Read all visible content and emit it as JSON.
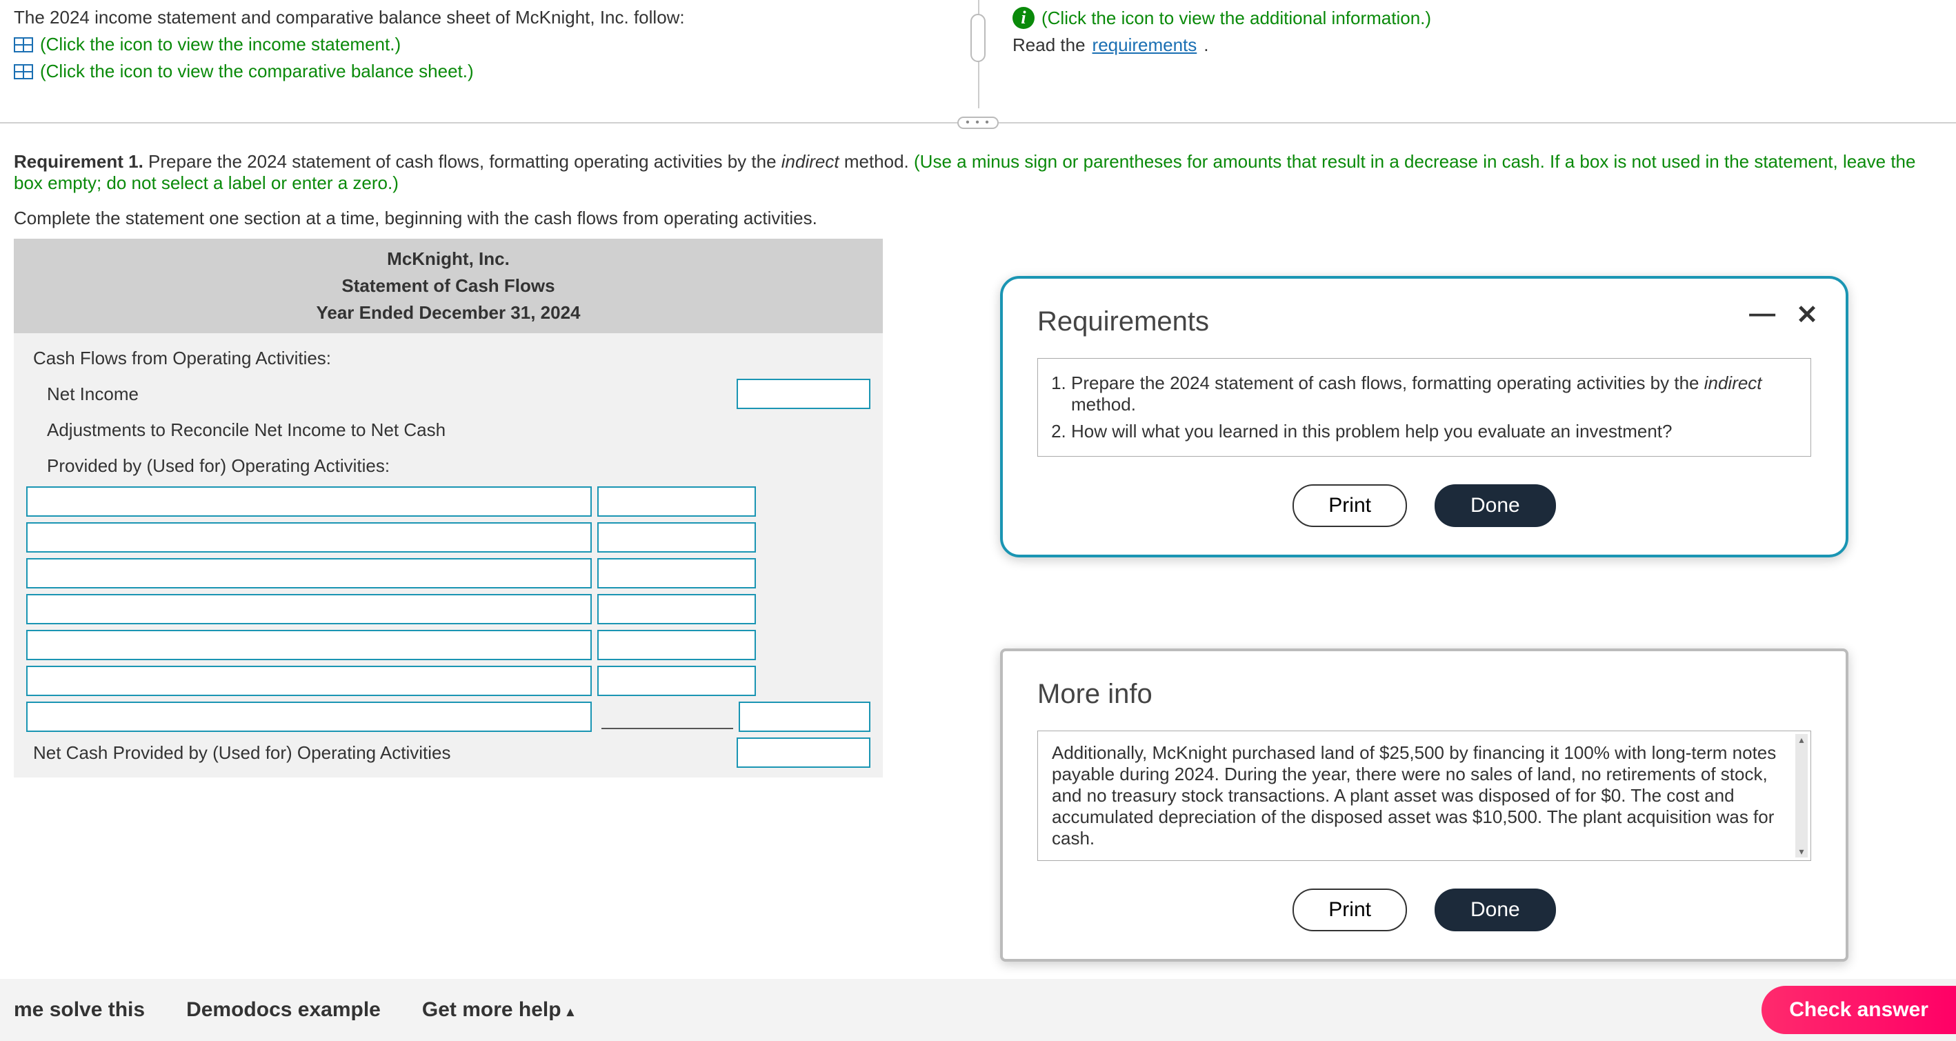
{
  "top": {
    "intro": "The 2024 income statement and comparative balance sheet of McKnight, Inc. follow:",
    "link_income": "(Click the icon to view the income statement.)",
    "link_balance": "(Click the icon to view the comparative balance sheet.)",
    "link_additional": "(Click the icon to view the additional information.)",
    "read_the": "Read the ",
    "requirements_link": "requirements",
    "period": "."
  },
  "hr_pill": "• • •",
  "requirement": {
    "label": "Requirement 1.",
    "text_a": " Prepare the 2024 statement of cash flows, formatting operating activities by the ",
    "italic": "indirect",
    "text_b": " method. ",
    "green": "(Use a minus sign or parentheses for amounts that result in a decrease in cash. If a box is not used in the statement, leave the box empty; do not select a label or enter a zero.)"
  },
  "instruction": "Complete the statement one section at a time, beginning with the cash flows from operating activities.",
  "worksheet": {
    "company": "McKnight, Inc.",
    "title": "Statement of Cash Flows",
    "period": "Year Ended December 31, 2024",
    "row_cfoa": "Cash Flows from Operating Activities:",
    "row_ni": "Net Income",
    "row_adj1": "Adjustments to Reconcile Net Income to Net Cash",
    "row_adj2": "Provided by (Used for) Operating Activities:",
    "row_net": "Net Cash Provided by (Used for) Operating Activities"
  },
  "dialog_req": {
    "title": "Requirements",
    "item1_a": "Prepare the 2024 statement of cash flows, formatting operating activities by the ",
    "item1_italic": "indirect",
    "item1_b": " method.",
    "item2": "How will what you learned in this problem help you evaluate an investment?",
    "print": "Print",
    "done": "Done",
    "minimize": "—",
    "close": "✕"
  },
  "dialog_info": {
    "title": "More info",
    "body": "Additionally, McKnight purchased land of $25,500 by financing it 100% with long-term notes payable during 2024. During the year, there were no sales of land, no retirements of stock, and no treasury stock transactions. A plant asset was disposed of for $0. The cost and accumulated depreciation of the disposed asset was $10,500. The plant acquisition was for cash.",
    "print": "Print",
    "done": "Done",
    "arrow_up": "▴",
    "arrow_down": "▾"
  },
  "footer": {
    "help_me": "me solve this",
    "demodocs": "Demodocs example",
    "get_more": "Get more help ",
    "caret": "▴",
    "check": "Check answer"
  }
}
